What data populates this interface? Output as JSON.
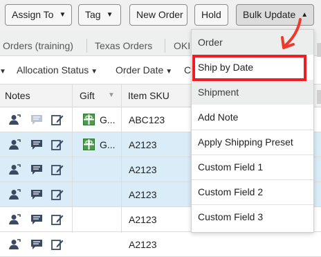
{
  "toolbar": {
    "assign_to": "Assign To",
    "tag": "Tag",
    "new_order": "New Order",
    "hold": "Hold",
    "bulk_update": "Bulk Update"
  },
  "tabs": [
    "Orders (training)",
    "Texas Orders",
    "OKI"
  ],
  "filters": [
    "Allocation Status",
    "Order Date",
    "C"
  ],
  "table": {
    "headers": {
      "notes": "Notes",
      "gift": "Gift",
      "item_sku": "Item SKU"
    },
    "rows": [
      {
        "gift_text": "G...",
        "sku": "ABC123",
        "selected": false
      },
      {
        "gift_text": "G...",
        "sku": "A2123",
        "selected": true
      },
      {
        "gift_text": "",
        "sku": "A2123",
        "selected": true
      },
      {
        "gift_text": "",
        "sku": "A2123",
        "selected": true
      },
      {
        "gift_text": "",
        "sku": "A2123",
        "selected": false
      },
      {
        "gift_text": "",
        "sku": "A2123",
        "selected": false
      }
    ]
  },
  "menu": {
    "header_order": "Order",
    "ship_by_date": "Ship by Date",
    "header_shipment": "Shipment",
    "add_note": "Add Note",
    "apply_shipping_preset": "Apply Shipping Preset",
    "custom_field_1": "Custom Field 1",
    "custom_field_2": "Custom Field 2",
    "custom_field_3": "Custom Field 3"
  },
  "colors": {
    "selected_row": "#d9ecf8",
    "highlight": "#ee1c25",
    "gift_green": "#4c9a4c"
  }
}
